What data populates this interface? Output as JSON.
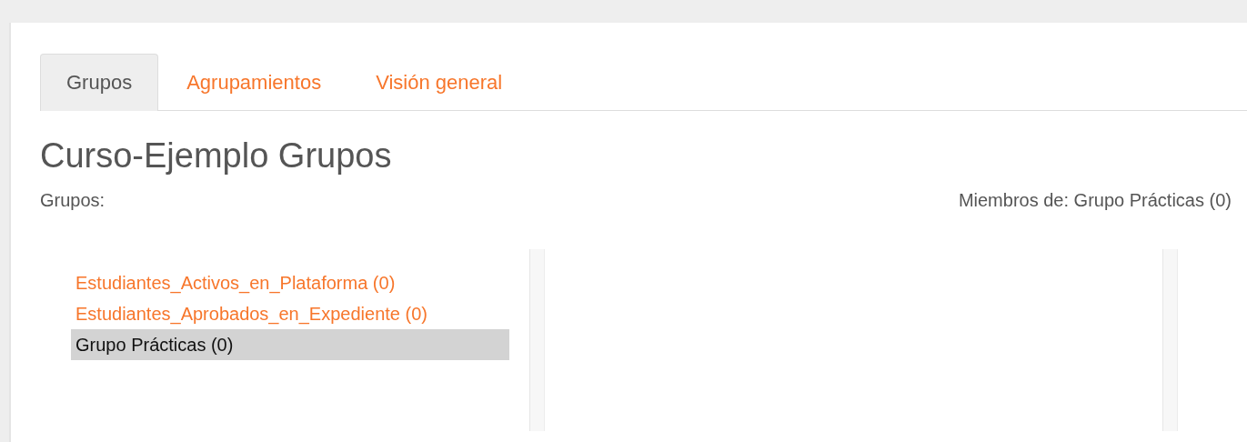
{
  "tabs": [
    {
      "label": "Grupos",
      "selected": true
    },
    {
      "label": "Agrupamientos",
      "selected": false
    },
    {
      "label": "Visión general",
      "selected": false
    }
  ],
  "title": "Curso-Ejemplo Grupos",
  "groups_label": "Grupos:",
  "members_label": "Miembros de: Grupo Prácticas (0)",
  "groups": [
    {
      "label": "Estudiantes_Activos_en_Plataforma (0)",
      "selected": false
    },
    {
      "label": "Estudiantes_Aprobados_en_Expediente (0)",
      "selected": false
    },
    {
      "label": "Grupo Prácticas (0)",
      "selected": true
    }
  ]
}
